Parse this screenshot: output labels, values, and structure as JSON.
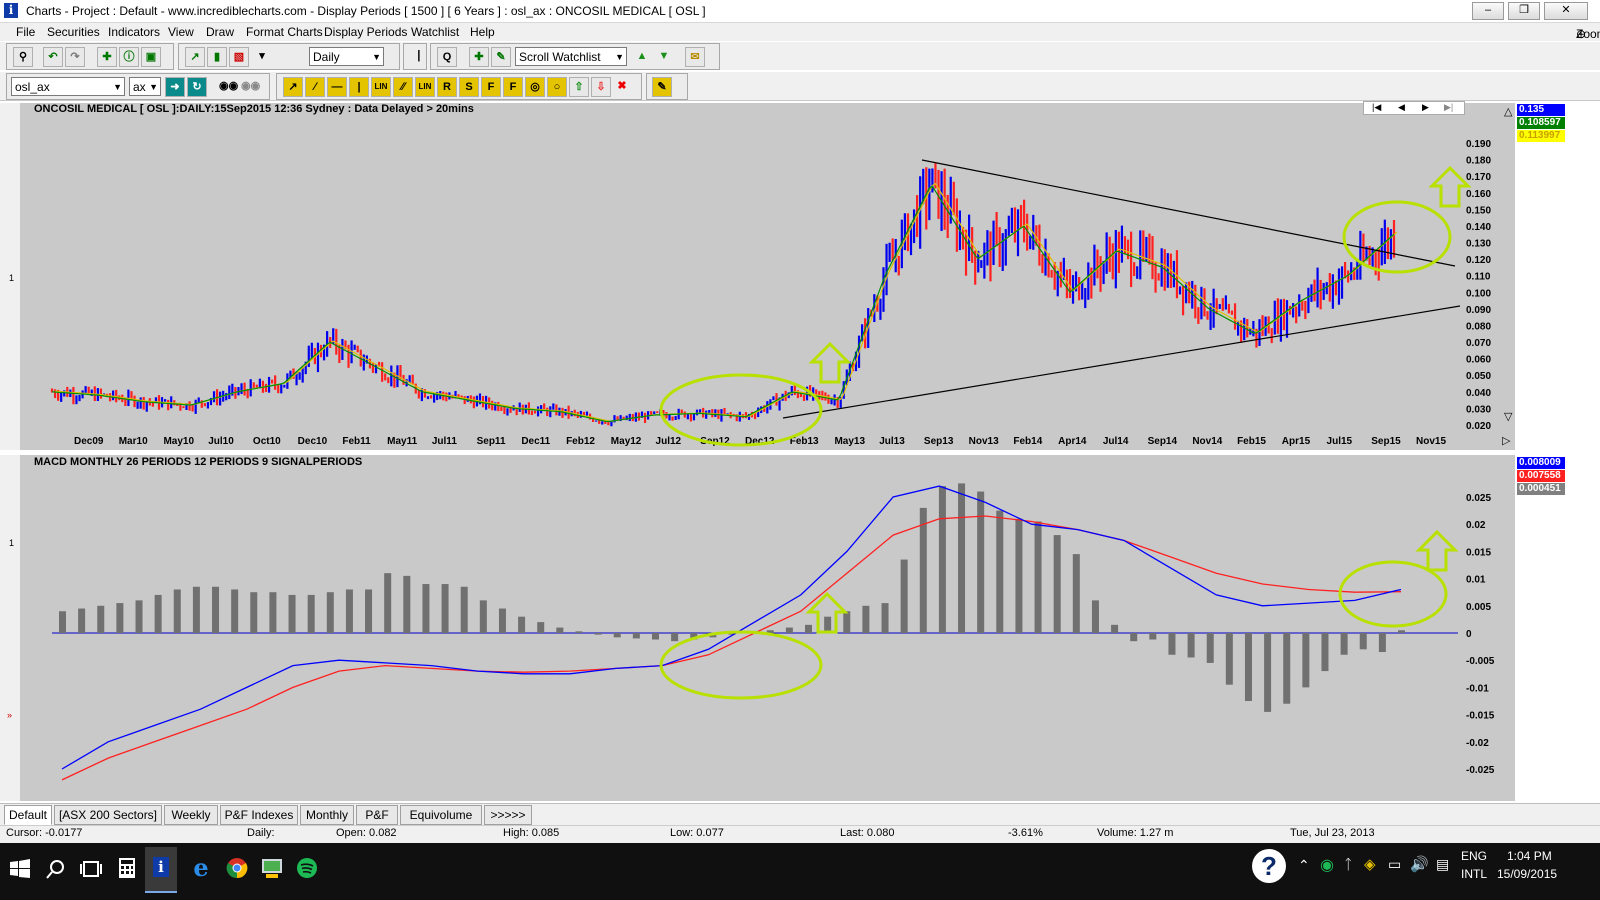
{
  "window": {
    "title": "Charts - Project : Default - www.incrediblecharts.com - Display Periods  [ 1500 ]  [ 6 Years ] : osl_ax : ONCOSIL MEDICAL  [ OSL ]",
    "zoom_label": "Zoom"
  },
  "menu": [
    "File",
    "Securities",
    "Indicators",
    "View",
    "Draw",
    "Format Charts",
    "Display Periods",
    "Watchlist",
    "Help"
  ],
  "toolbar": {
    "period_select": "Daily",
    "watchlist_select": "Scroll Watchlist",
    "symbol_input": "osl_ax",
    "exchange_select": "ax"
  },
  "price_chart": {
    "header": "ONCOSIL MEDICAL [ OSL ]:DAILY:15Sep2015 12:36 Sydney : Data Delayed > 20mins",
    "left_scale": "1",
    "y_ticks": [
      "0.190",
      "0.180",
      "0.170",
      "0.160",
      "0.150",
      "0.140",
      "0.130",
      "0.120",
      "0.110",
      "0.100",
      "0.090",
      "0.080",
      "0.070",
      "0.060",
      "0.050",
      "0.040",
      "0.030",
      "0.020"
    ],
    "x_ticks": [
      "Dec09",
      "Mar10",
      "May10",
      "Jul10",
      "Oct10",
      "Dec10",
      "Feb11",
      "May11",
      "Jul11",
      "Sep11",
      "Dec11",
      "Feb12",
      "May12",
      "Jul12",
      "Sep12",
      "Dec12",
      "Feb13",
      "May13",
      "Jul13",
      "Sep13",
      "Nov13",
      "Feb14",
      "Apr14",
      "Jul14",
      "Sep14",
      "Nov14",
      "Feb15",
      "Apr15",
      "Jul15",
      "Sep15",
      "Nov15"
    ],
    "value_boxes": [
      {
        "text": "0.135",
        "bg": "#0000ff",
        "fg": "#ffffff"
      },
      {
        "text": "0.108597",
        "bg": "#008000",
        "fg": "#ffffff"
      },
      {
        "text": "0.113997",
        "bg": "#ffff00",
        "fg": "#c8a000"
      }
    ]
  },
  "macd_chart": {
    "header": "MACD MONTHLY 26 PERIODS 12 PERIODS 9 SIGNALPERIODS",
    "left_scale": "1",
    "y_ticks": [
      "0.025",
      "0.02",
      "0.015",
      "0.01",
      "0.005",
      "0",
      "-0.005",
      "-0.01",
      "-0.015",
      "-0.02",
      "-0.025"
    ],
    "value_boxes": [
      {
        "text": "0.008009",
        "bg": "#0000ff",
        "fg": "#ffffff"
      },
      {
        "text": "0.007558",
        "bg": "#ff2020",
        "fg": "#ffffff"
      },
      {
        "text": "0.000451",
        "bg": "#808080",
        "fg": "#ffffff"
      }
    ]
  },
  "chart_data": [
    {
      "type": "line",
      "title": "ONCOSIL MEDICAL [ OSL ]:DAILY:15Sep2015 12:36 Sydney : Data Delayed > 20mins",
      "x": [
        "Dec09",
        "Mar10",
        "May10",
        "Jul10",
        "Oct10",
        "Dec10",
        "Feb11",
        "May11",
        "Jul11",
        "Sep11",
        "Dec11",
        "Feb12",
        "May12",
        "Jul12",
        "Sep12",
        "Dec12",
        "Feb13",
        "May13",
        "Jul13",
        "Sep13",
        "Nov13",
        "Feb14",
        "Apr14",
        "Jul14",
        "Sep14",
        "Nov14",
        "Feb15",
        "Apr15",
        "Jul15",
        "Sep15"
      ],
      "series": [
        {
          "values": [
            0.04,
            0.038,
            0.034,
            0.032,
            0.04,
            0.045,
            0.07,
            0.055,
            0.04,
            0.035,
            0.03,
            0.028,
            0.022,
            0.026,
            0.027,
            0.025,
            0.04,
            0.035,
            0.11,
            0.165,
            0.12,
            0.14,
            0.1,
            0.125,
            0.115,
            0.09,
            0.075,
            0.095,
            0.11,
            0.135
          ]
        }
      ],
      "ylim": [
        0.015,
        0.195
      ]
    },
    {
      "type": "bar",
      "title": "MACD MONTHLY 26 PERIODS 12 PERIODS 9 SIGNALPERIODS",
      "series": [
        {
          "values": [
            0.004,
            0.0045,
            0.005,
            0.0055,
            0.006,
            0.007,
            0.008,
            0.0085,
            0.0085,
            0.008,
            0.0075,
            0.0075,
            0.007,
            0.007,
            0.0075,
            0.008,
            0.008,
            0.011,
            0.0105,
            0.009,
            0.009,
            0.0085,
            0.006,
            0.0045,
            0.003,
            0.002,
            0.001,
            0.0003,
            -0.0003,
            -0.0008,
            -0.001,
            -0.0012,
            -0.0015,
            -0.0012,
            -0.0008,
            -0.0003,
            0.0002,
            0.0005,
            0.001,
            0.0015,
            0.003,
            0.004,
            0.005,
            0.0055,
            0.0135,
            0.023,
            0.027,
            0.0275,
            0.026,
            0.0225,
            0.021,
            0.0205,
            0.018,
            0.0145,
            0.006,
            0.0015,
            -0.0015,
            -0.0012,
            -0.004,
            -0.0045,
            -0.0055,
            -0.0095,
            -0.0125,
            -0.0145,
            -0.013,
            -0.01,
            -0.007,
            -0.004,
            -0.003,
            -0.0035,
            0.0005
          ]
        },
        {
          "values": [
            -0.025,
            -0.02,
            -0.017,
            -0.014,
            -0.01,
            -0.006,
            -0.005,
            -0.0055,
            -0.006,
            -0.007,
            -0.0075,
            -0.0075,
            -0.0065,
            -0.006,
            -0.003,
            0.002,
            0.007,
            0.015,
            0.025,
            0.027,
            0.024,
            0.02,
            0.019,
            0.017,
            0.012,
            0.007,
            0.005,
            0.0055,
            0.006,
            0.008
          ]
        },
        {
          "values": [
            -0.027,
            -0.023,
            -0.02,
            -0.017,
            -0.014,
            -0.01,
            -0.007,
            -0.006,
            -0.0065,
            -0.007,
            -0.0072,
            -0.007,
            -0.0065,
            -0.006,
            -0.004,
            0.0,
            0.004,
            0.011,
            0.018,
            0.021,
            0.0215,
            0.0205,
            0.019,
            0.017,
            0.014,
            0.011,
            0.009,
            0.008,
            0.0075,
            0.0076
          ]
        }
      ],
      "ylim": [
        -0.028,
        0.028
      ]
    }
  ],
  "tabs": [
    "Default",
    "[ASX 200 Sectors]",
    "Weekly",
    "P&F Indexes",
    "Monthly",
    "P&F",
    "Equivolume",
    ">>>>>"
  ],
  "status": {
    "cursor": "Cursor: -0.0177",
    "period": "Daily:",
    "open": "Open: 0.082",
    "high": "High: 0.085",
    "low": "Low: 0.077",
    "last": "Last: 0.080",
    "change": "-3.61%",
    "volume": "Volume: 1.27 m",
    "date": "Tue, Jul 23, 2013"
  },
  "taskbar": {
    "lang1": "ENG",
    "lang2": "INTL",
    "time": "1:04 PM",
    "date": "15/09/2015"
  }
}
